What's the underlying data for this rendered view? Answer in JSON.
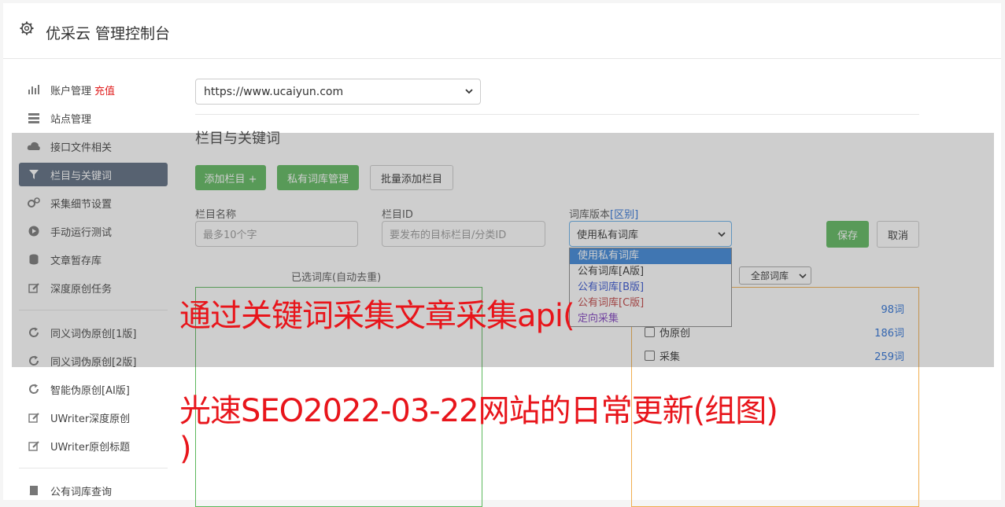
{
  "header": {
    "title": "优采云 管理控制台",
    "icon": "gear-icon"
  },
  "sidebar": {
    "items": [
      {
        "label": "账户管理",
        "badge": "充值",
        "icon": "bar-chart-icon"
      },
      {
        "label": "站点管理",
        "icon": "server-icon"
      },
      {
        "label": "接口文件相关",
        "icon": "cloud-upload-icon"
      },
      {
        "label": "栏目与关键词",
        "icon": "filter-icon",
        "active": true
      },
      {
        "label": "采集细节设置",
        "icon": "cogs-icon"
      },
      {
        "label": "手动运行测试",
        "icon": "play-circle-icon"
      },
      {
        "label": "文章暂存库",
        "icon": "database-icon"
      },
      {
        "label": "深度原创任务",
        "icon": "edit-icon"
      },
      {
        "label": "同义词伪原创[1版]",
        "icon": "refresh-icon"
      },
      {
        "label": "同义词伪原创[2版]",
        "icon": "refresh-icon"
      },
      {
        "label": "智能伪原创[AI版]",
        "icon": "refresh-icon"
      },
      {
        "label": "UWriter深度原创",
        "icon": "edit-icon"
      },
      {
        "label": "UWriter原创标题",
        "icon": "edit-icon"
      },
      {
        "label": "公有词库查询",
        "icon": "book-icon"
      }
    ]
  },
  "main": {
    "site_select": "https://www.ucaiyun.com",
    "section_title": "栏目与关键词",
    "buttons": {
      "add_column": "添加栏目 +",
      "private_lib": "私有词库管理",
      "batch_add": "批量添加栏目",
      "save": "保存",
      "cancel": "取消"
    },
    "fields": {
      "name_label": "栏目名称",
      "name_placeholder": "最多10个字",
      "id_label": "栏目ID",
      "id_placeholder": "要发布的目标栏目/分类ID",
      "lib_label": "词库版本",
      "lib_diff": "[区别]",
      "lib_value": "使用私有词库"
    },
    "dropdown_options": [
      "使用私有词库",
      "公有词库[A版]",
      "公有词库[B版]",
      "公有词库[C版]",
      "定向采集"
    ],
    "selected_lib_title": "已选词库(自动去重)",
    "filter_select": "全部词库",
    "libraries": [
      {
        "label": "",
        "count": "98词"
      },
      {
        "label": "伪原创",
        "count": "186词"
      },
      {
        "label": "采集",
        "count": "259词"
      }
    ]
  },
  "overlay": {
    "line1": "通过关键词采集文章采集api(",
    "line2": "光速SEO2022-03-22网站的日常更新(组图)",
    "line3": ")"
  },
  "colors": {
    "accent_green": "#5cb85c",
    "active_nav": "#5a6a7e",
    "headline_red": "#e8151b",
    "link_blue": "#2a6fd6"
  }
}
